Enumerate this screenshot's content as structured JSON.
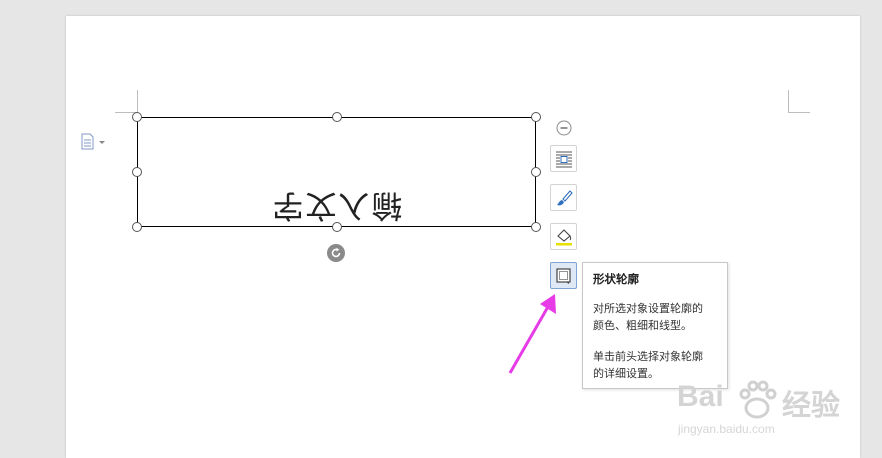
{
  "shape": {
    "text": "输入文字"
  },
  "toolbar": {
    "buttons": [
      {
        "icon": "wrap-text-icon"
      },
      {
        "icon": "brush-icon"
      },
      {
        "icon": "fill-bucket-icon"
      },
      {
        "icon": "shape-outline-icon"
      }
    ]
  },
  "tooltip": {
    "title": "形状轮廓",
    "line1": "对所选对象设置轮廓的",
    "line2": "颜色、粗细和线型。",
    "line3": "单击前头选择对象轮廓",
    "line4": "的详细设置。"
  },
  "watermark": {
    "logo_text": "Bai",
    "brand": "经验",
    "url": "jingyan.baidu.com"
  },
  "colors": {
    "arrow": "#e63be6",
    "page": "#ffffff",
    "background": "#e6e6e6",
    "active_button": "#dfe9f5"
  }
}
